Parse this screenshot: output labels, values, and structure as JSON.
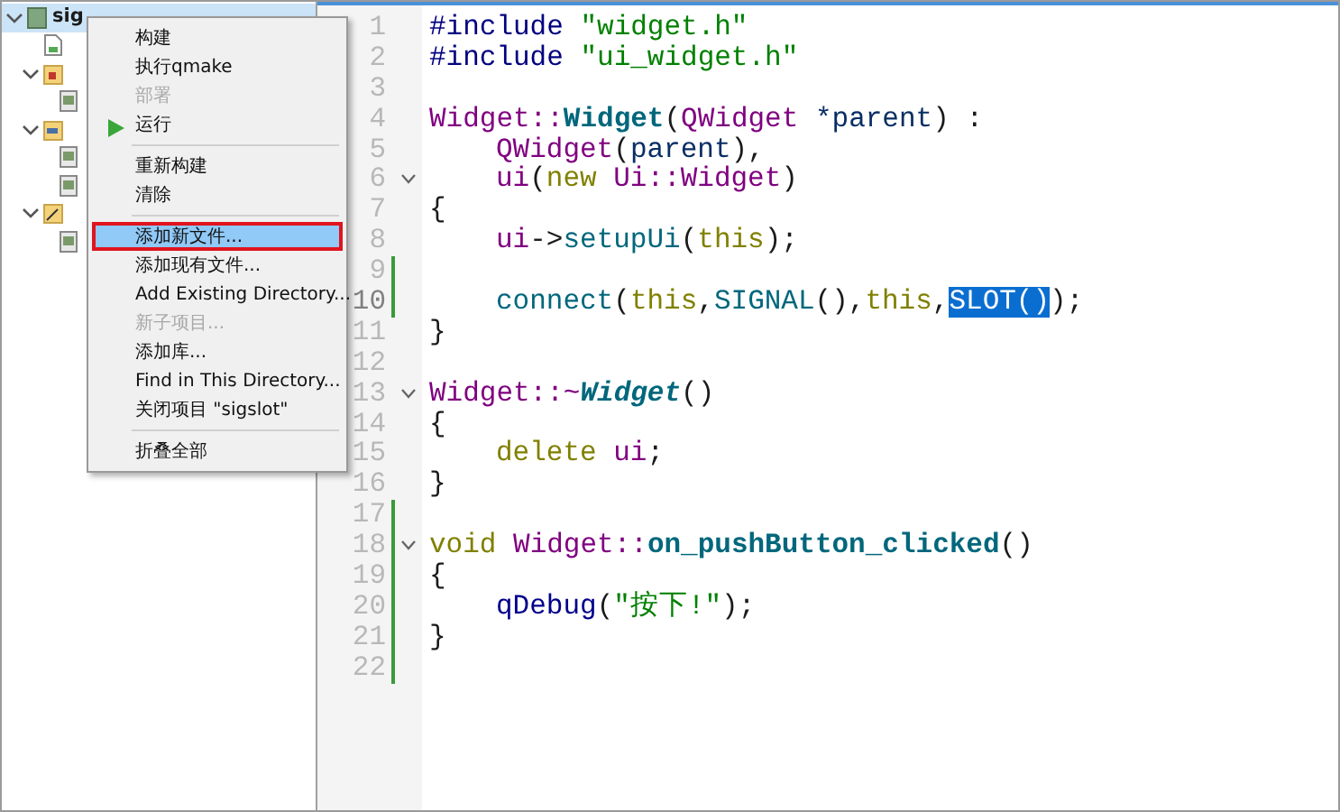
{
  "project_tree": [
    {
      "label": "sig",
      "kind": "project",
      "expanded": true,
      "selected": true,
      "children": [
        {
          "kind": "pro_file"
        },
        {
          "kind": "headers",
          "expanded": true,
          "children": [
            {
              "kind": "file"
            }
          ]
        },
        {
          "kind": "sources",
          "expanded": true,
          "children": [
            {
              "kind": "file"
            },
            {
              "kind": "file"
            }
          ]
        },
        {
          "kind": "forms",
          "expanded": true,
          "children": [
            {
              "kind": "file"
            }
          ]
        }
      ]
    }
  ],
  "context_menu": [
    {
      "kind": "item",
      "label": "构建",
      "disabled": false,
      "selected": false
    },
    {
      "kind": "item",
      "label": "执行qmake",
      "disabled": false,
      "selected": false
    },
    {
      "kind": "item",
      "label": "部署",
      "disabled": true,
      "selected": false
    },
    {
      "kind": "run",
      "label": "运行",
      "disabled": false,
      "selected": false
    },
    {
      "kind": "separator"
    },
    {
      "kind": "item",
      "label": "重新构建",
      "disabled": false,
      "selected": false
    },
    {
      "kind": "item",
      "label": "清除",
      "disabled": false,
      "selected": false
    },
    {
      "kind": "separator"
    },
    {
      "kind": "item",
      "label": "添加新文件...",
      "disabled": false,
      "selected": true,
      "outlined": true
    },
    {
      "kind": "item",
      "label": "添加现有文件...",
      "disabled": false,
      "selected": false
    },
    {
      "kind": "item",
      "label": "Add Existing Directory...",
      "disabled": false,
      "selected": false
    },
    {
      "kind": "item",
      "label": "新子项目...",
      "disabled": true,
      "selected": false
    },
    {
      "kind": "item",
      "label": "添加库...",
      "disabled": false,
      "selected": false
    },
    {
      "kind": "item",
      "label": "Find in This Directory...",
      "disabled": false,
      "selected": false
    },
    {
      "kind": "item",
      "label": "关闭项目 \"sigslot\"",
      "disabled": false,
      "selected": false
    },
    {
      "kind": "separator"
    },
    {
      "kind": "item",
      "label": "折叠全部",
      "disabled": false,
      "selected": false
    }
  ],
  "editor": {
    "lines": [
      {
        "number": "1",
        "tokens": [
          {
            "text": "#include",
            "kind": "pre"
          },
          {
            "text": " \"widget.h\"",
            "kind": "str"
          }
        ]
      },
      {
        "number": "2",
        "tokens": [
          {
            "text": "#include",
            "kind": "pre"
          },
          {
            "text": " \"ui_widget.h\"",
            "kind": "str"
          }
        ]
      },
      {
        "number": "3"
      },
      {
        "number": "4",
        "tokens": [
          {
            "text": "Widget::",
            "kind": "type"
          },
          {
            "text": "Widget",
            "kind": "decl"
          },
          {
            "text": "(",
            "kind": "plain"
          },
          {
            "text": "QWidget",
            "kind": "type"
          },
          {
            "text": " *parent",
            "kind": "param"
          },
          {
            "text": ") :",
            "kind": "plain"
          }
        ]
      },
      {
        "number": "5",
        "indented": true,
        "tokens": [
          {
            "text": "QWidget",
            "kind": "type"
          },
          {
            "text": "(",
            "kind": "plain"
          },
          {
            "text": "parent",
            "kind": "param"
          },
          {
            "text": "),",
            "kind": "plain"
          }
        ]
      },
      {
        "number": "6",
        "indented": true,
        "fold": true,
        "tokens": [
          {
            "text": "ui",
            "kind": "type"
          },
          {
            "text": "(",
            "kind": "plain"
          },
          {
            "text": "new",
            "kind": "kw"
          },
          {
            "text": " Ui::Widget",
            "kind": "type"
          },
          {
            "text": ")",
            "kind": "plain"
          }
        ]
      },
      {
        "number": "7",
        "tokens": [
          {
            "text": "{",
            "kind": "plain"
          }
        ]
      },
      {
        "number": "8",
        "indented": true,
        "tokens": [
          {
            "text": "ui",
            "kind": "type"
          },
          {
            "text": "->",
            "kind": "plain"
          },
          {
            "text": "setupUi",
            "kind": "func"
          },
          {
            "text": "(",
            "kind": "plain"
          },
          {
            "text": "this",
            "kind": "kw"
          },
          {
            "text": ");",
            "kind": "plain"
          }
        ]
      },
      {
        "number": "9",
        "changed": true
      },
      {
        "number": "10",
        "changed": true,
        "current": true,
        "indented": true,
        "tokens": [
          {
            "text": "connect",
            "kind": "func"
          },
          {
            "text": "(",
            "kind": "plain"
          },
          {
            "text": "this",
            "kind": "kw"
          },
          {
            "text": ",",
            "kind": "plain"
          },
          {
            "text": "SIGNAL",
            "kind": "func"
          },
          {
            "text": "(),",
            "kind": "plain"
          },
          {
            "text": "this",
            "kind": "kw"
          },
          {
            "text": ",",
            "kind": "plain"
          },
          {
            "text": "SLOT()",
            "kind": "sel"
          },
          {
            "text": ");",
            "kind": "plain"
          }
        ]
      },
      {
        "number": "11",
        "tokens": [
          {
            "text": "}",
            "kind": "plain"
          }
        ]
      },
      {
        "number": "12"
      },
      {
        "number": "13",
        "fold": true,
        "tokens": [
          {
            "text": "Widget::~",
            "kind": "type"
          },
          {
            "text": "Widget",
            "kind": "decli"
          },
          {
            "text": "()",
            "kind": "plain"
          }
        ]
      },
      {
        "number": "14",
        "tokens": [
          {
            "text": "{",
            "kind": "plain"
          }
        ]
      },
      {
        "number": "15",
        "indented": true,
        "tokens": [
          {
            "text": "delete",
            "kind": "kw"
          },
          {
            "text": " ui",
            "kind": "type"
          },
          {
            "text": ";",
            "kind": "plain"
          }
        ]
      },
      {
        "number": "16",
        "tokens": [
          {
            "text": "}",
            "kind": "plain"
          }
        ]
      },
      {
        "number": "17",
        "changed": true
      },
      {
        "number": "18",
        "changed": true,
        "fold": true,
        "tokens": [
          {
            "text": "void",
            "kind": "kw"
          },
          {
            "text": " Widget::",
            "kind": "type"
          },
          {
            "text": "on_pushButton_clicked",
            "kind": "decl"
          },
          {
            "text": "()",
            "kind": "plain"
          }
        ]
      },
      {
        "number": "19",
        "changed": true,
        "tokens": [
          {
            "text": "{",
            "kind": "plain"
          }
        ]
      },
      {
        "number": "20",
        "changed": true,
        "indented": true,
        "tokens": [
          {
            "text": "qDebug",
            "kind": "call"
          },
          {
            "text": "(",
            "kind": "plain"
          },
          {
            "text": "\"按下!\"",
            "kind": "str"
          },
          {
            "text": ");",
            "kind": "plain"
          }
        ]
      },
      {
        "number": "21",
        "changed": true,
        "tokens": [
          {
            "text": "}",
            "kind": "plain"
          }
        ]
      },
      {
        "number": "22",
        "changed": true
      }
    ]
  }
}
